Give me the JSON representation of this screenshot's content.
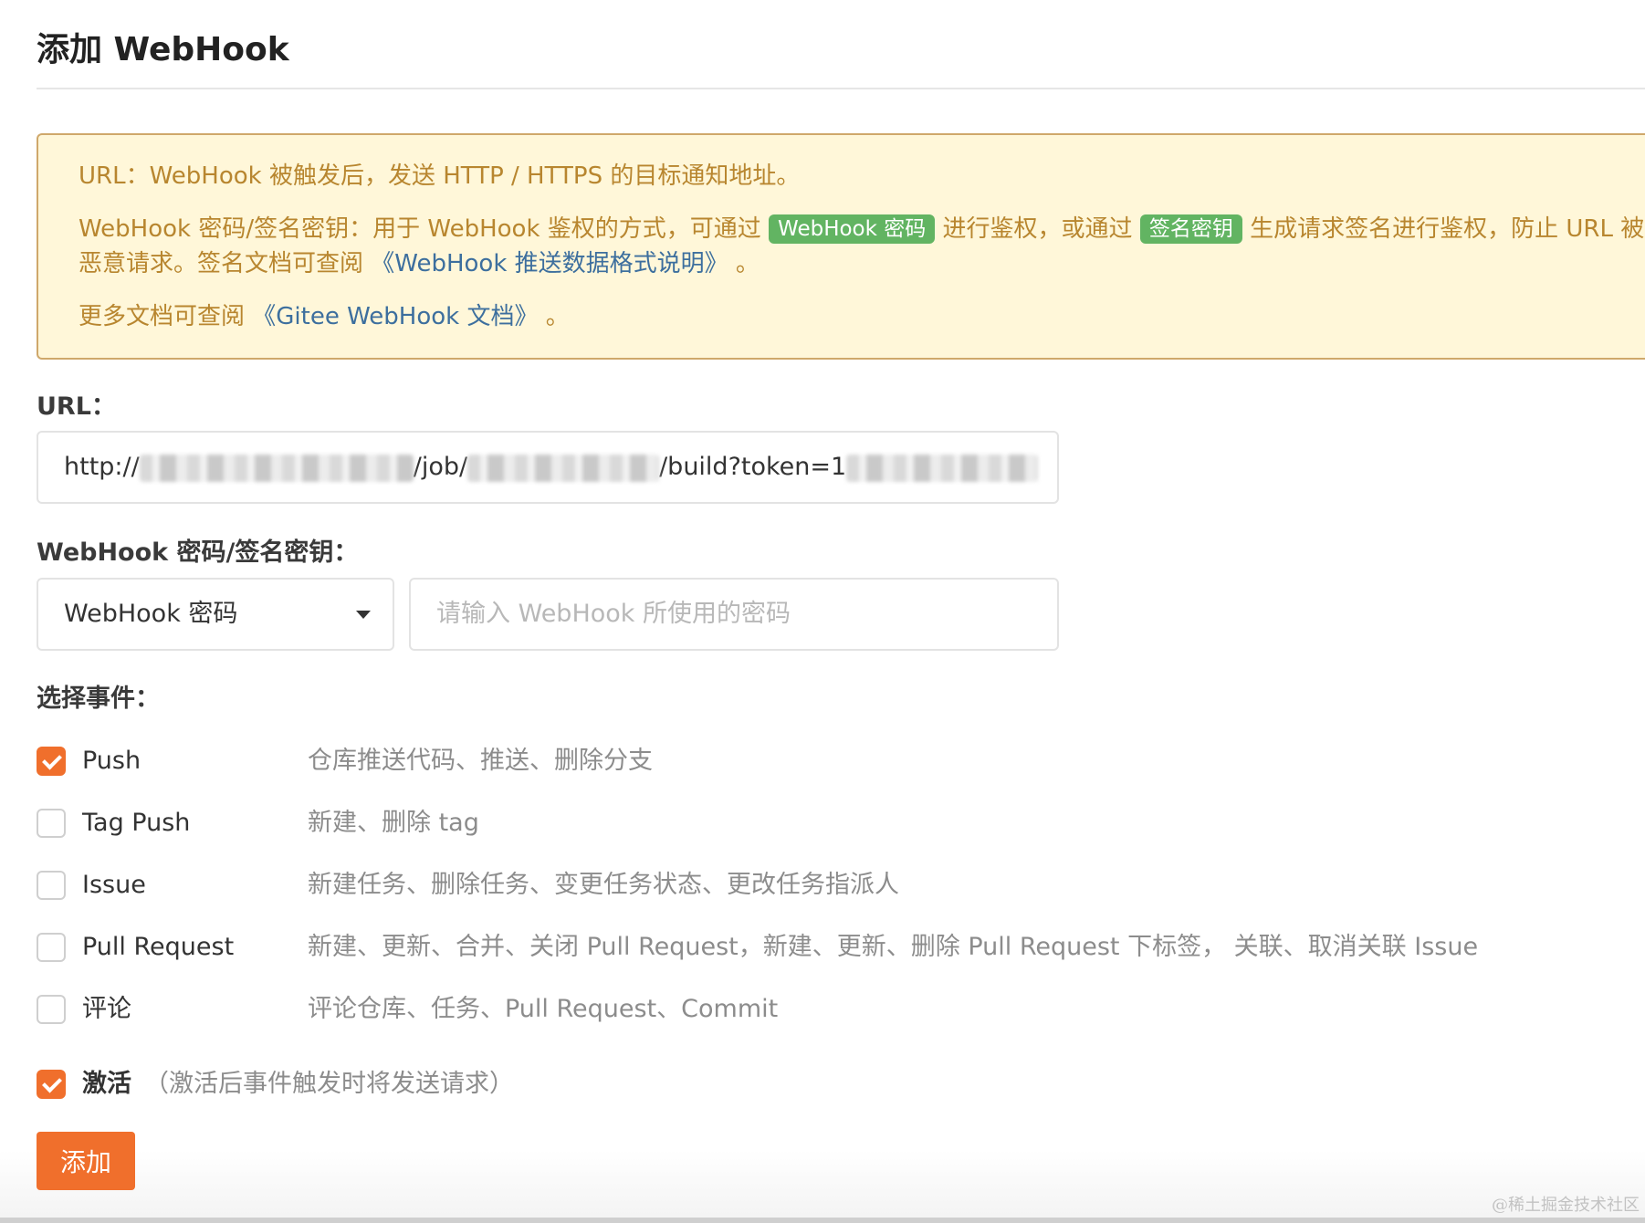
{
  "page_title": "添加 WebHook",
  "notice": {
    "url_line": "URL：WebHook 被触发后，发送 HTTP / HTTPS 的目标通知地址。",
    "pwd_line_a": "WebHook 密码/签名密钥：用于 WebHook 鉴权的方式，可通过",
    "tag_webhook_pwd": "WebHook 密码",
    "pwd_line_b": "进行鉴权，或通过",
    "tag_sign_key": "签名密钥",
    "pwd_line_c": "生成请求签名进行鉴权，防止 URL 被恶意请求。签名文档可查阅",
    "format_link": "《WebHook 推送数据格式说明》",
    "period": "。",
    "more_docs": "更多文档可查阅",
    "gitee_docs_link": "《Gitee WebHook 文档》",
    "period2": "。"
  },
  "url_field": {
    "label": "URL：",
    "value_part1": "http://",
    "value_part2": "/job/",
    "value_part3": "/build?token=1"
  },
  "secret_field": {
    "label": "WebHook 密码/签名密钥：",
    "type_selected": "WebHook 密码",
    "placeholder": "请输入 WebHook 所使用的密码"
  },
  "events": {
    "label": "选择事件：",
    "items": [
      {
        "name": "Push",
        "desc": "仓库推送代码、推送、删除分支",
        "checked": true
      },
      {
        "name": "Tag Push",
        "desc": "新建、删除 tag",
        "checked": false
      },
      {
        "name": "Issue",
        "desc": "新建任务、删除任务、变更任务状态、更改任务指派人",
        "checked": false
      },
      {
        "name": "Pull Request",
        "desc": "新建、更新、合并、关闭 Pull Request，新建、更新、删除 Pull Request 下标签， 关联、取消关联 Issue",
        "checked": false
      },
      {
        "name": "评论",
        "desc": "评论仓库、任务、Pull Request、Commit",
        "checked": false
      }
    ]
  },
  "activate": {
    "label": "激活",
    "note": "（激活后事件触发时将发送请求）",
    "checked": true
  },
  "submit_label": "添加",
  "watermark": "@稀土掘金技术社区",
  "colors": {
    "accent": "#f06f2c",
    "notice_bg": "#fff7d9",
    "notice_text": "#b8862f",
    "tag_green": "#62b462",
    "link": "#3d6f9e"
  }
}
